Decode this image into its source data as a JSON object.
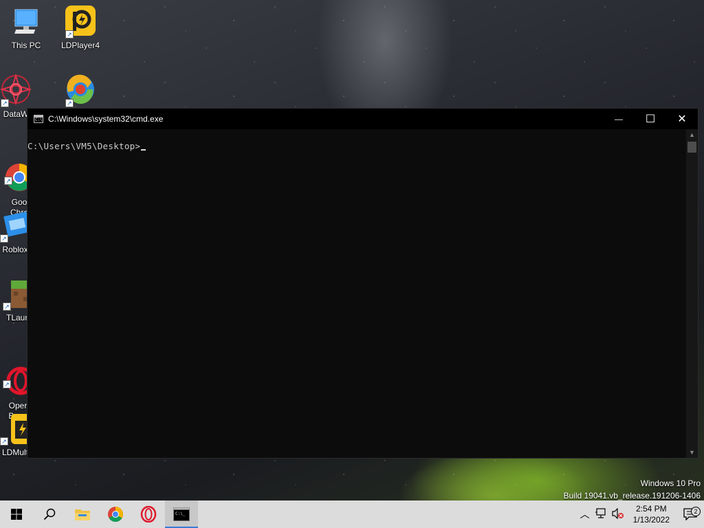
{
  "desktop": {
    "icons": [
      {
        "label": "This PC",
        "icon": "this-pc-icon"
      },
      {
        "label": "LDPlayer4",
        "icon": "ldplayer-icon"
      },
      {
        "label": "DataW",
        "icon": "datawing-icon"
      },
      {
        "label": "",
        "icon": "app-swirl-icon"
      },
      {
        "label": "Goo\nChro",
        "icon": "chrome-icon"
      },
      {
        "label": "Roblox",
        "icon": "roblox-icon"
      },
      {
        "label": "TLaun",
        "icon": "minecraft-launcher-icon"
      },
      {
        "label": "Oper\nBrow",
        "icon": "opera-icon"
      },
      {
        "label": "LDMult",
        "icon": "ldmultiplayer-icon"
      }
    ],
    "shortcut_arrow": "↗"
  },
  "cmd_window": {
    "title": "C:\\Windows\\system32\\cmd.exe",
    "icon_text": "C:\\",
    "prompt": "C:\\Users\\VM5\\Desktop>",
    "minimize_glyph": "—",
    "maximize_glyph": "☐",
    "close_glyph": "✕",
    "scroll_up": "▲",
    "scroll_down": "▼"
  },
  "watermark": {
    "line1": "Windows 10 Pro",
    "line2": "Build 19041.vb_release.191206-1406"
  },
  "taskbar": {
    "apps": [
      "start-button",
      "search-button",
      "file-explorer",
      "chrome",
      "opera",
      "cmd"
    ],
    "tray": {
      "chevron": "︿",
      "time": "2:54 PM",
      "date": "1/13/2022",
      "notification_count": "2"
    }
  },
  "colors": {
    "console_bg": "#0c0c0c",
    "console_text": "#cccccc",
    "taskbar_bg": "#dcdcdc",
    "accent": "#3a7bd5"
  }
}
